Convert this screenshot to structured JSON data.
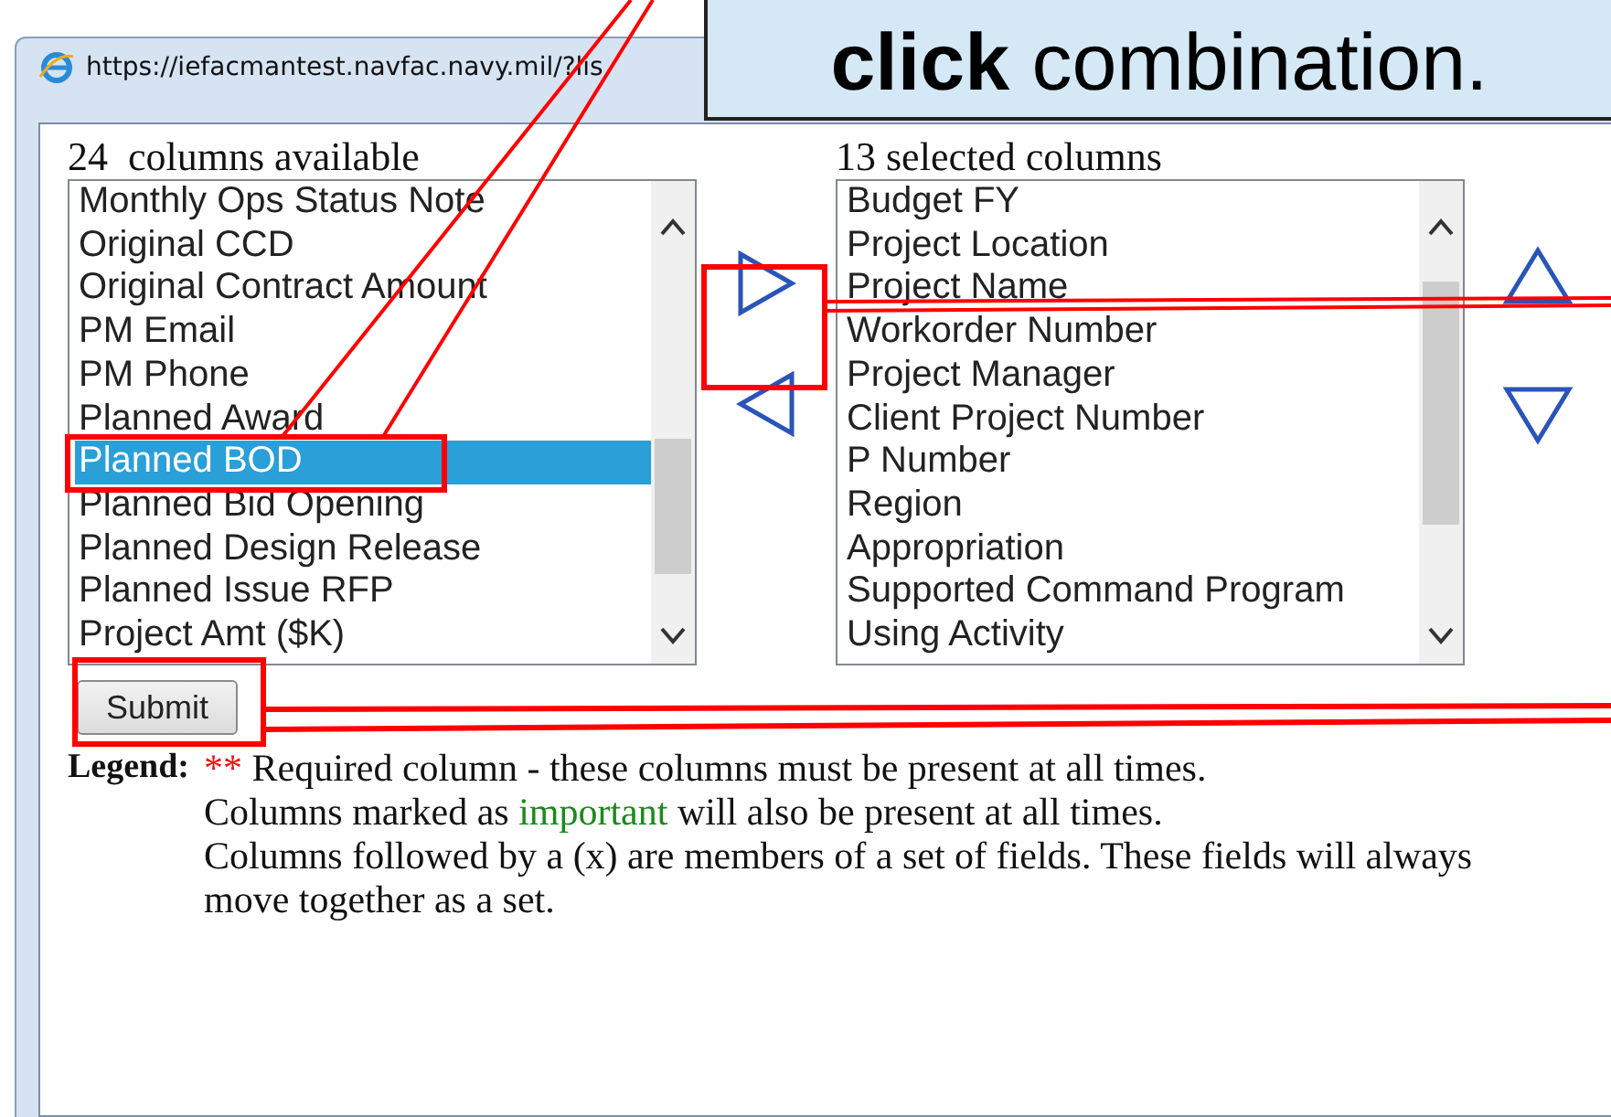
{
  "window": {
    "url": "https://iefacmantest.navfac.navy.mil/?lis"
  },
  "callout": {
    "text": "**click** combination."
  },
  "available": {
    "heading": "24  columns available",
    "items": [
      {
        "label": "Monthly Ops Status Note",
        "selected": false
      },
      {
        "label": "Original CCD",
        "selected": false
      },
      {
        "label": "Original Contract Amount",
        "selected": false
      },
      {
        "label": "PM Email",
        "selected": false
      },
      {
        "label": "PM Phone",
        "selected": false
      },
      {
        "label": "Planned Award",
        "selected": false
      },
      {
        "label": "Planned BOD",
        "selected": true
      },
      {
        "label": "Planned Bid Opening",
        "selected": false
      },
      {
        "label": "Planned Design Release",
        "selected": false
      },
      {
        "label": "Planned Issue RFP",
        "selected": false
      },
      {
        "label": "Project Amt ($K)",
        "selected": false
      }
    ]
  },
  "selected_columns": {
    "heading": "13 selected columns",
    "items": [
      {
        "label": "Budget FY",
        "selected": false
      },
      {
        "label": "Project Location",
        "selected": false
      },
      {
        "label": "Project Name",
        "selected": false
      },
      {
        "label": "Workorder Number",
        "selected": false
      },
      {
        "label": "Project Manager",
        "selected": false
      },
      {
        "label": "Client Project Number",
        "selected": false
      },
      {
        "label": "P Number",
        "selected": false
      },
      {
        "label": "Region",
        "selected": false
      },
      {
        "label": "Appropriation",
        "selected": false
      },
      {
        "label": "Supported Command Program",
        "selected": false
      },
      {
        "label": "Using Activity",
        "selected": false
      }
    ]
  },
  "submit": {
    "label": "Submit"
  },
  "legend": {
    "label": "Legend:",
    "lines": [
      [
        {
          "kind": "required",
          "text": "**"
        },
        {
          "kind": "plain",
          "text": " Required column - these columns must be present at all times."
        }
      ],
      [
        {
          "kind": "plain",
          "text": "Columns marked as "
        },
        {
          "kind": "important",
          "text": "important"
        },
        {
          "kind": "plain",
          "text": " will also be present at all times."
        }
      ],
      [
        {
          "kind": "plain",
          "text": "Columns followed by a (x) are members of a set of fields. These fields will always move together as a set."
        }
      ]
    ]
  }
}
